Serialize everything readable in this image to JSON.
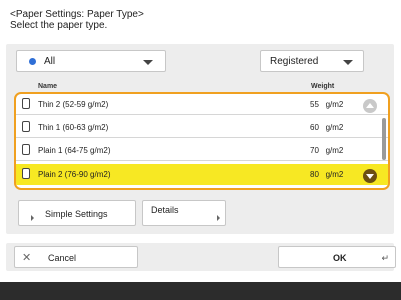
{
  "header": {
    "title": "<Paper Settings: Paper Type>",
    "instruction": "Select the paper type."
  },
  "filters": {
    "category": "All",
    "registration": "Registered"
  },
  "table": {
    "columns": [
      "Name",
      "Weight"
    ],
    "rows": [
      {
        "name": "Thin 2 (52-59 g/m2)",
        "weight": "55",
        "unit": "g/m2",
        "selected": false
      },
      {
        "name": "Thin 1 (60-63 g/m2)",
        "weight": "60",
        "unit": "g/m2",
        "selected": false
      },
      {
        "name": "Plain 1 (64-75 g/m2)",
        "weight": "70",
        "unit": "g/m2",
        "selected": false
      },
      {
        "name": "Plain 2 (76-90 g/m2)",
        "weight": "80",
        "unit": "g/m2",
        "selected": true
      }
    ]
  },
  "buttons": {
    "simple_settings": "Simple Settings",
    "details": "Details",
    "cancel": "Cancel",
    "ok": "OK"
  },
  "icons": {
    "category_dot": "blue-dot-icon",
    "dropdown": "chevron-down-icon",
    "cancel": "close-icon",
    "ok": "return-icon"
  },
  "colors": {
    "selection_highlight": "#f7e823",
    "focus_border": "#f0a020",
    "category_dot": "#2f6fd6"
  }
}
